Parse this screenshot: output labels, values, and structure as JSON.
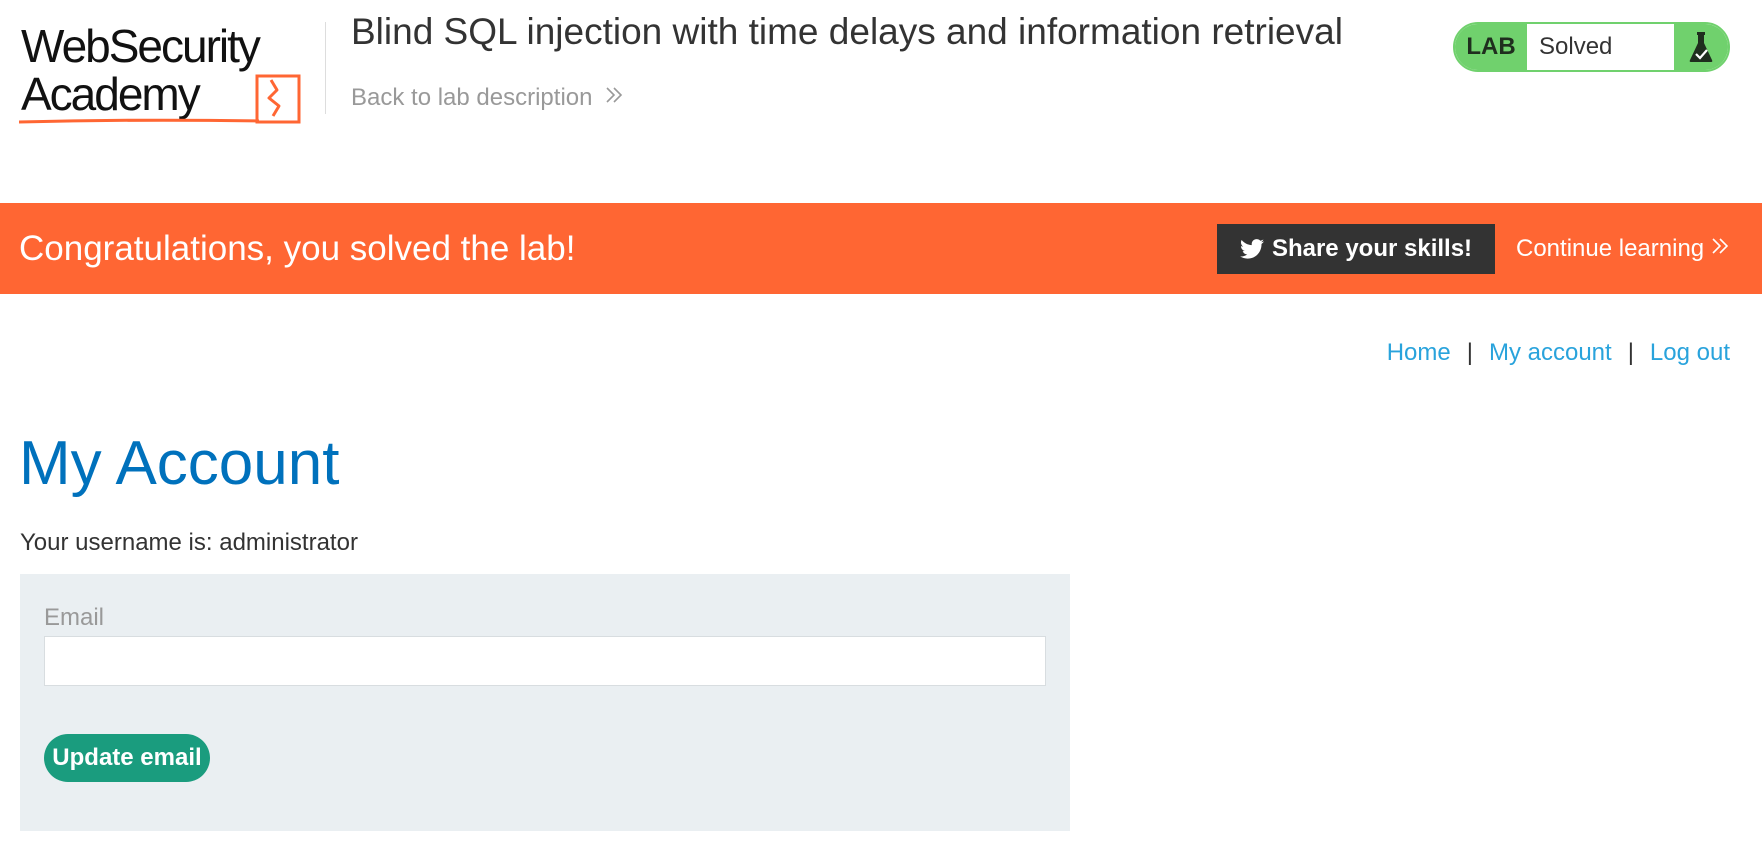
{
  "header": {
    "logo": {
      "line1": "WebSecurity",
      "line2": "Academy"
    },
    "lab_title": "Blind SQL injection with time delays and information retrieval",
    "back_link": "Back to lab description",
    "lab_status": {
      "tag": "LAB",
      "state": "Solved",
      "icon": "flask-check-icon"
    }
  },
  "banner": {
    "message": "Congratulations, you solved the lab!",
    "share_label": "Share your skills!",
    "share_icon": "twitter-icon",
    "continue_label": "Continue learning"
  },
  "nav": {
    "items": [
      {
        "label": "Home"
      },
      {
        "label": "My account"
      },
      {
        "label": "Log out"
      }
    ],
    "separator": "|"
  },
  "main": {
    "title": "My Account",
    "username_text": "Your username is: administrator",
    "email_form": {
      "label": "Email",
      "value": "",
      "placeholder": "",
      "submit_label": "Update email"
    }
  },
  "colors": {
    "banner": "#ff6633",
    "lab_green": "#70d16d",
    "title_blue": "#0071bc",
    "link_blue": "#29a3dc",
    "button_green": "#1a9c7e",
    "panel_bg": "#eaeff2"
  }
}
